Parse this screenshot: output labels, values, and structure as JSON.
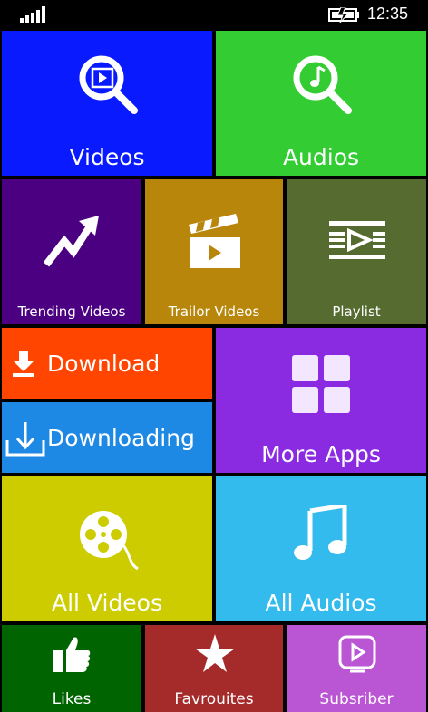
{
  "status": {
    "time": "12:35"
  },
  "tiles": {
    "videos": {
      "label": "Videos",
      "color": "#0a1aff"
    },
    "audios": {
      "label": "Audios",
      "color": "#33cc33"
    },
    "trending": {
      "label": "Trending Videos",
      "color": "#4b0082"
    },
    "trailor": {
      "label": "Trailor Videos",
      "color": "#b8860b"
    },
    "playlist": {
      "label": "Playlist",
      "color": "#556b2f"
    },
    "download": {
      "label": "Download",
      "color": "#ff4500"
    },
    "downloading": {
      "label": "Downloading",
      "color": "#1e88e5"
    },
    "more_apps": {
      "label": "More Apps",
      "color": "#8a2be2"
    },
    "all_videos": {
      "label": "All Videos",
      "color": "#cccc00"
    },
    "all_audios": {
      "label": "All Audios",
      "color": "#33bbee"
    },
    "likes": {
      "label": "Likes",
      "color": "#006400"
    },
    "favrouites": {
      "label": "Favrouites",
      "color": "#a52a2a"
    },
    "subsriber": {
      "label": "Subsriber",
      "color": "#ba55d3"
    }
  }
}
